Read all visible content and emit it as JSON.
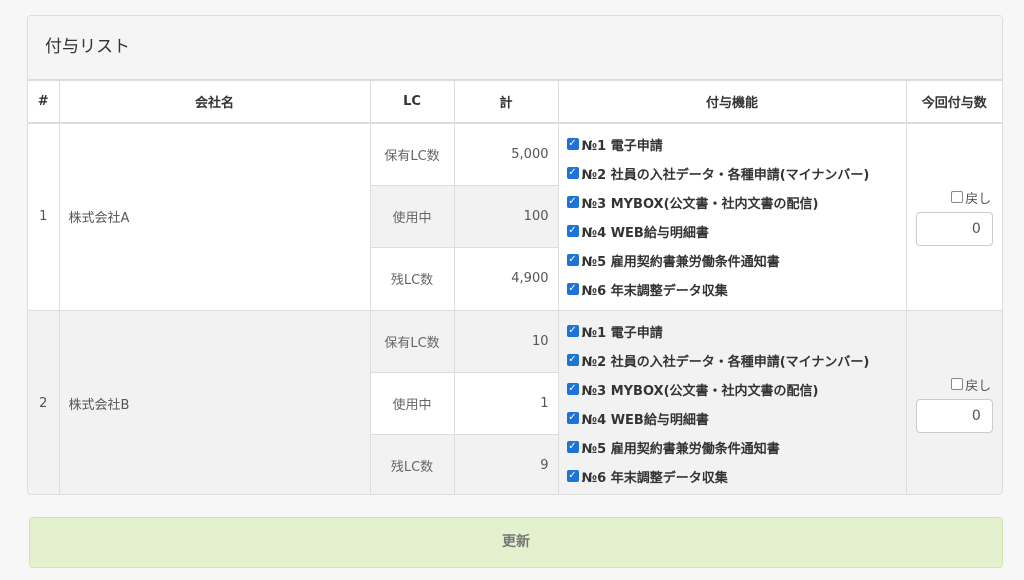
{
  "panel": {
    "title": "付与リスト"
  },
  "headers": {
    "num": "#",
    "company": "会社名",
    "lc": "LC",
    "total": "計",
    "functions": "付与機能",
    "give_count": "今回付与数"
  },
  "rows": [
    {
      "num": "1",
      "company": "株式会社A",
      "lc": [
        {
          "label": "保有LC数",
          "value": "5,000"
        },
        {
          "label": "使用中",
          "value": "100"
        },
        {
          "label": "残LC数",
          "value": "4,900"
        }
      ],
      "functions": [
        "№1 電子申請",
        "№2 社員の入社データ・各種申請(マイナンバー)",
        "№3 MYBOX(公文書・社内文書の配信)",
        "№4 WEB給与明細書",
        "№5 雇用契約書兼労働条件通知書",
        "№6 年末調整データ収集"
      ],
      "return_label": "戻し",
      "give_value": "0"
    },
    {
      "num": "2",
      "company": "株式会社B",
      "lc": [
        {
          "label": "保有LC数",
          "value": "10"
        },
        {
          "label": "使用中",
          "value": "1"
        },
        {
          "label": "残LC数",
          "value": "9"
        }
      ],
      "functions": [
        "№1 電子申請",
        "№2 社員の入社データ・各種申請(マイナンバー)",
        "№3 MYBOX(公文書・社内文書の配信)",
        "№4 WEB給与明細書",
        "№5 雇用契約書兼労働条件通知書",
        "№6 年末調整データ収集"
      ],
      "return_label": "戻し",
      "give_value": "0"
    }
  ],
  "checkbox_glyph": "✓",
  "update_button": {
    "label": "更新"
  },
  "colors": {
    "checkbox": "#1e73d9",
    "update_button_bg": "#e3f1cf",
    "row_shade": "#f2f2f2"
  }
}
